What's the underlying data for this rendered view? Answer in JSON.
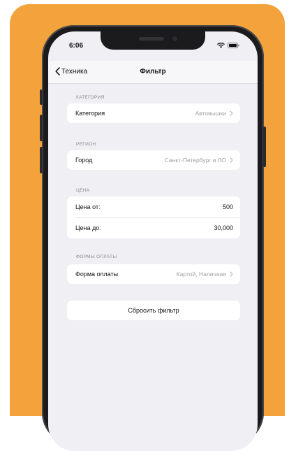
{
  "status_bar": {
    "time": "6:06"
  },
  "nav": {
    "back_label": "Техника",
    "title": "Фильтр"
  },
  "sections": {
    "category": {
      "header": "КАТЕГОРИЯ",
      "label": "Категория",
      "value": "Автовышки"
    },
    "region": {
      "header": "РЕГИОН",
      "label": "Город",
      "value": "Санкт-Петербург и ЛО"
    },
    "price": {
      "header": "ЦЕНА",
      "from_label": "Цена от:",
      "from_value": "500",
      "to_label": "Цена до:",
      "to_value": "30,000"
    },
    "payment": {
      "header": "ФОРМЫ ОПЛАТЫ",
      "label": "Форма оплаты",
      "value": "Картой, Наличная"
    }
  },
  "actions": {
    "reset_label": "Сбросить фильтр"
  },
  "colors": {
    "background_accent": "#F4A23C",
    "screen_background": "#efeff4",
    "secondary_text": "#a0a0a6"
  },
  "icons": {
    "back": "chevron-left-icon",
    "disclosure": "chevron-right-icon",
    "wifi": "wifi-icon",
    "battery": "battery-icon"
  }
}
